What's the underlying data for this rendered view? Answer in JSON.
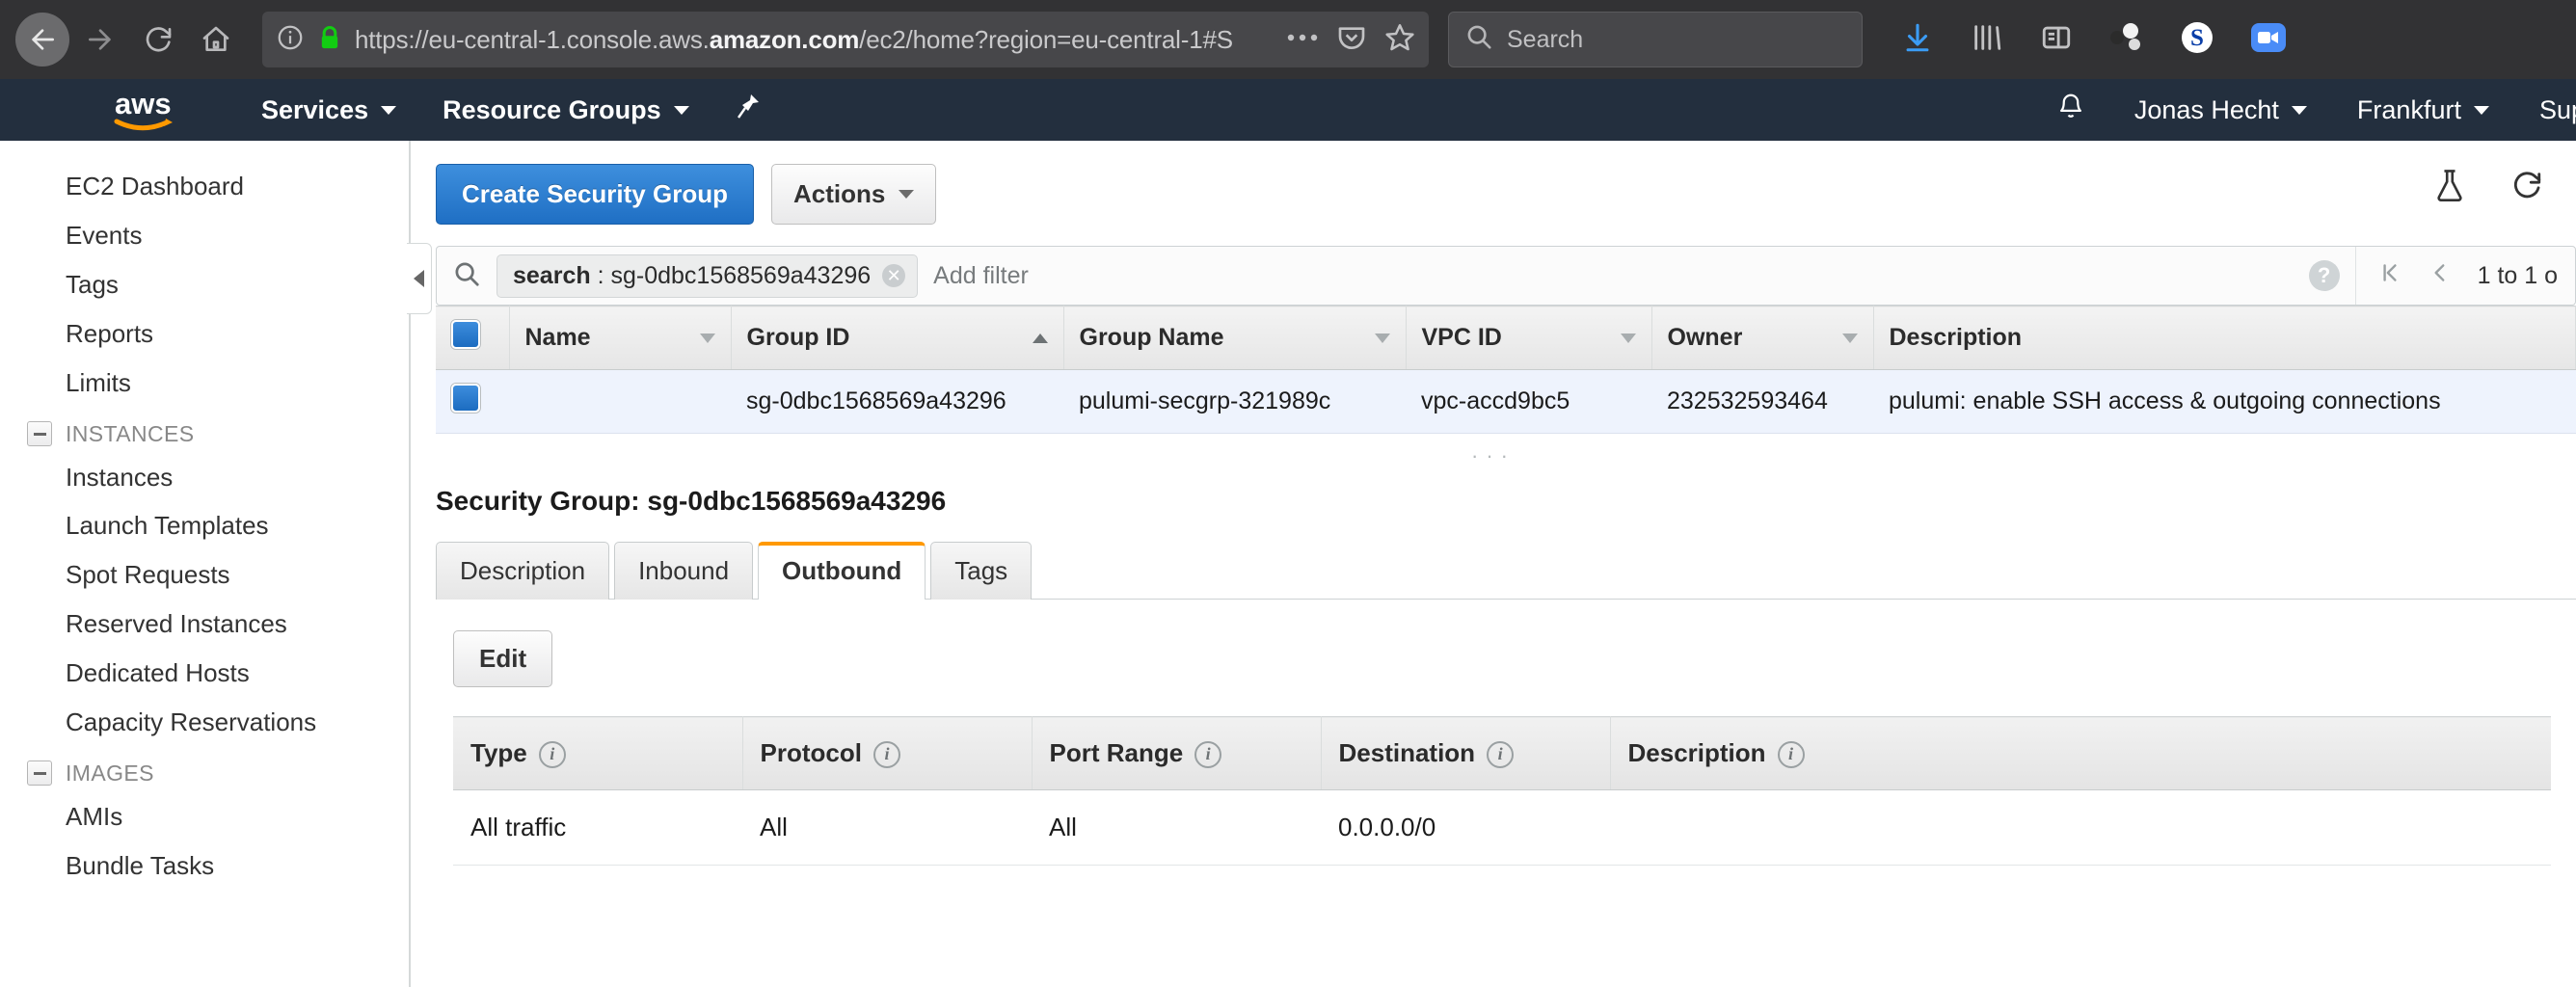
{
  "browser": {
    "url_prefix": "https://eu-central-1.console.aws.",
    "url_domain": "amazon.com",
    "url_suffix": "/ec2/home?region=eu-central-1#S",
    "search_placeholder": "Search",
    "icons": {
      "back": "back-arrow-icon",
      "forward": "forward-arrow-icon",
      "reload": "reload-icon",
      "home": "home-icon",
      "page_info": "page-info-icon",
      "lock": "https-lock-icon",
      "more": "page-actions-ellipsis-icon",
      "pocket": "pocket-icon",
      "bookmark": "bookmark-star-icon",
      "search": "search-icon",
      "downloads": "downloads-icon",
      "library": "library-icon",
      "sidebar": "sidebar-toggle-icon",
      "extension_molecule": "molecule-extension-icon",
      "extension_sophos": "sophos-extension-icon",
      "extension_zoom": "zoom-video-icon"
    }
  },
  "aws_nav": {
    "logo": "aws-logo",
    "services": "Services",
    "resource_groups": "Resource Groups",
    "pin": "pin-icon",
    "bell": "notifications-bell-icon",
    "user": "Jonas Hecht",
    "region": "Frankfurt",
    "support": "Sup"
  },
  "sidebar": {
    "items": [
      {
        "label": "EC2 Dashboard",
        "type": "link"
      },
      {
        "label": "Events",
        "type": "link"
      },
      {
        "label": "Tags",
        "type": "link"
      },
      {
        "label": "Reports",
        "type": "link"
      },
      {
        "label": "Limits",
        "type": "link"
      },
      {
        "label": "INSTANCES",
        "type": "group"
      },
      {
        "label": "Instances",
        "type": "link"
      },
      {
        "label": "Launch Templates",
        "type": "link"
      },
      {
        "label": "Spot Requests",
        "type": "link"
      },
      {
        "label": "Reserved Instances",
        "type": "link"
      },
      {
        "label": "Dedicated Hosts",
        "type": "link"
      },
      {
        "label": "Capacity Reservations",
        "type": "link"
      },
      {
        "label": "IMAGES",
        "type": "group"
      },
      {
        "label": "AMIs",
        "type": "link"
      },
      {
        "label": "Bundle Tasks",
        "type": "link"
      }
    ]
  },
  "toolbar": {
    "create_label": "Create Security Group",
    "actions_label": "Actions",
    "beaker_icon": "experiment-beaker-icon",
    "refresh_icon": "refresh-icon"
  },
  "filter": {
    "chip_key": "search",
    "chip_separator": " : ",
    "chip_value": "sg-0dbc1568569a43296",
    "add_filter_placeholder": "Add filter",
    "help_label": "?",
    "pager_text": "1 to 1 o"
  },
  "sg_table": {
    "columns": [
      {
        "label": "Name",
        "sort": "none"
      },
      {
        "label": "Group ID",
        "sort": "asc"
      },
      {
        "label": "Group Name",
        "sort": "none"
      },
      {
        "label": "VPC ID",
        "sort": "none"
      },
      {
        "label": "Owner",
        "sort": "none"
      },
      {
        "label": "Description",
        "sort": "none"
      }
    ],
    "rows": [
      {
        "name": "",
        "group_id": "sg-0dbc1568569a43296",
        "group_name": "pulumi-secgrp-321989c",
        "vpc_id": "vpc-accd9bc5",
        "owner": "232532593464",
        "description": "pulumi: enable SSH access & outgoing connections"
      }
    ]
  },
  "detail": {
    "title": "Security Group: sg-0dbc1568569a43296",
    "tabs": [
      {
        "label": "Description",
        "active": false
      },
      {
        "label": "Inbound",
        "active": false
      },
      {
        "label": "Outbound",
        "active": true
      },
      {
        "label": "Tags",
        "active": false
      }
    ],
    "edit_label": "Edit",
    "rules_columns": [
      "Type",
      "Protocol",
      "Port Range",
      "Destination",
      "Description"
    ],
    "rules_rows": [
      {
        "type": "All traffic",
        "protocol": "All",
        "port_range": "All",
        "destination": "0.0.0.0/0",
        "description": ""
      }
    ]
  },
  "colors": {
    "aws_navy": "#232f3e",
    "aws_orange": "#ff9900",
    "primary_blue": "#2a7fd4",
    "row_selected": "#eef3fd"
  }
}
